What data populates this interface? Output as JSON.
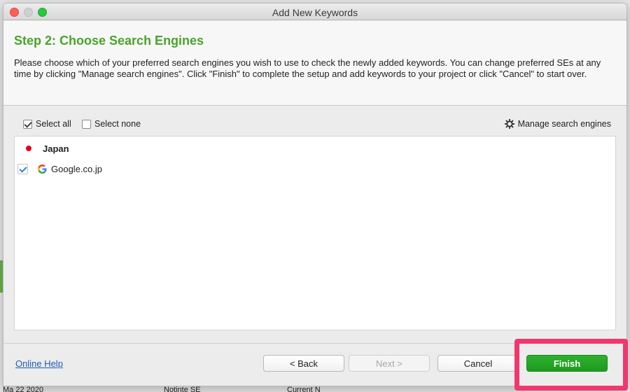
{
  "window": {
    "title": "Add New Keywords"
  },
  "header": {
    "step_title": "Step 2: Choose Search Engines",
    "description": "Please choose which of your preferred search engines you wish to use to check the newly added keywords. You can change preferred SEs at any time by clicking \"Manage search engines\". Click \"Finish\" to complete the setup and add keywords to your project or click \"Cancel\" to start over."
  },
  "toolbar": {
    "select_all_label": "Select all",
    "select_all_checked": true,
    "select_none_label": "Select none",
    "select_none_checked": false,
    "manage_label": "Manage search engines"
  },
  "list": {
    "groups": [
      {
        "label": "Japan",
        "flag_icon": "japan-flag-icon",
        "items": [
          {
            "label": "Google.co.jp",
            "checked": true,
            "icon": "google-icon"
          }
        ]
      }
    ]
  },
  "footer": {
    "online_help_label": "Online Help",
    "back_label": "< Back",
    "next_label": "Next >",
    "cancel_label": "Cancel",
    "finish_label": "Finish"
  },
  "background": {
    "fragments": [
      "Ma 22 2020",
      "Notinte SE",
      "Current N"
    ]
  },
  "colors": {
    "accent_green": "#4aa32a",
    "finish_green": "#1e9a1e",
    "highlight": "#f2366e",
    "link_blue": "#1f5bb8"
  }
}
